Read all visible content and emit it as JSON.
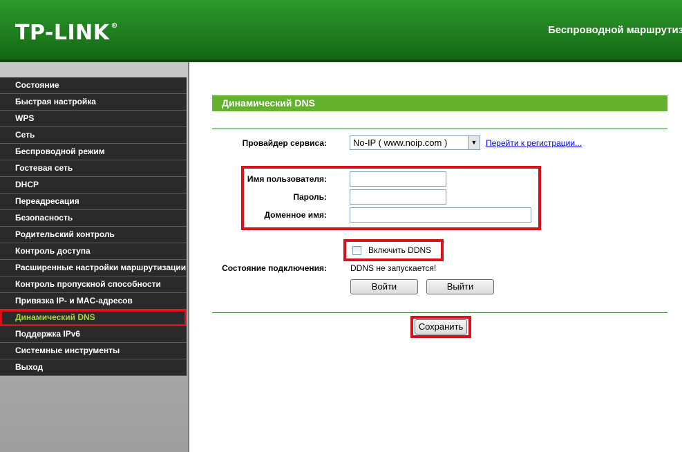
{
  "header": {
    "logo": "TP-LINK",
    "logo_mark": "®",
    "product": "Беспроводной маршрутизатор"
  },
  "sidebar": {
    "items": [
      {
        "label": "Состояние"
      },
      {
        "label": "Быстрая настройка"
      },
      {
        "label": "WPS"
      },
      {
        "label": "Сеть"
      },
      {
        "label": "Беспроводной режим"
      },
      {
        "label": "Гостевая сеть"
      },
      {
        "label": "DHCP"
      },
      {
        "label": "Переадресация"
      },
      {
        "label": "Безопасность"
      },
      {
        "label": "Родительский контроль"
      },
      {
        "label": "Контроль доступа"
      },
      {
        "label": "Расширенные настройки маршрутизации"
      },
      {
        "label": "Контроль пропускной способности"
      },
      {
        "label": "Привязка IP- и MAC-адресов"
      },
      {
        "label": "Динамический DNS",
        "active": true
      },
      {
        "label": "Поддержка IPv6"
      },
      {
        "label": "Системные инструменты"
      },
      {
        "label": "Выход"
      }
    ]
  },
  "main": {
    "title": "Динамический DNS",
    "provider_label": "Провайдер сервиса:",
    "provider_value": "No-IP ( www.noip.com )",
    "register_link": "Перейти к регистрации...",
    "username_label": "Имя пользователя:",
    "username_value": "",
    "password_label": "Пароль:",
    "password_value": "",
    "domain_label": "Доменное имя:",
    "domain_value": "",
    "enable_ddns_label": "Включить DDNS",
    "enable_ddns_checked": false,
    "status_label": "Состояние подключения:",
    "status_value": "DDNS не запускается!",
    "login_button": "Войти",
    "logout_button": "Выйти",
    "save_button": "Сохранить"
  },
  "colors": {
    "header_green": "#1f7e1f",
    "title_green": "#63b12c",
    "menu_bg": "#2a2a2a",
    "active_text": "#a8d832",
    "highlight_red": "#d9101a",
    "link": "#0000ee"
  }
}
